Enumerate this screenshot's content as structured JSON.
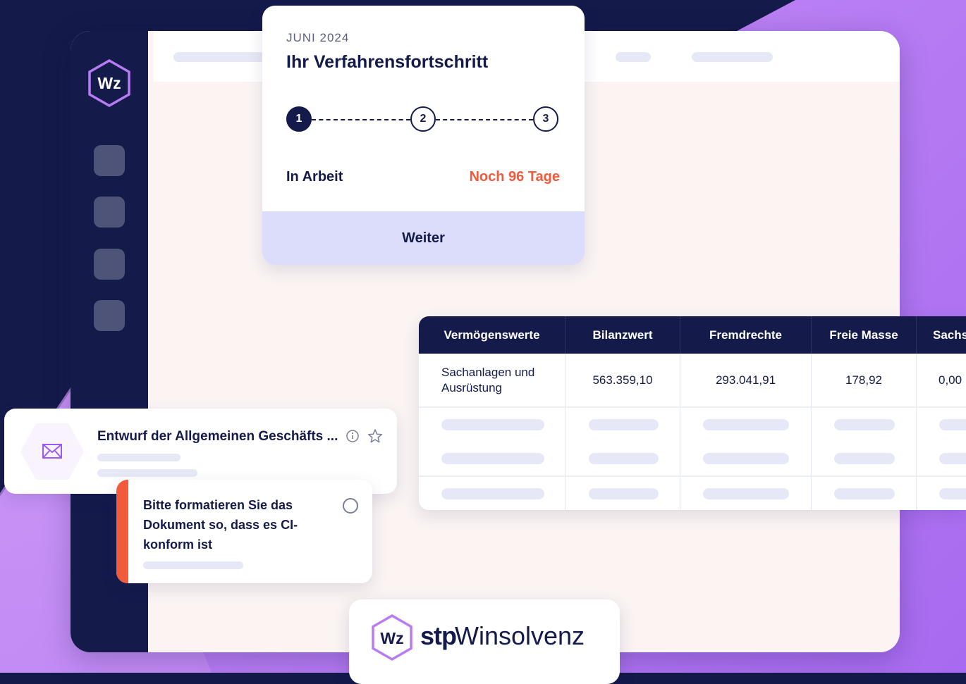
{
  "app": {
    "logo_text": "Wz"
  },
  "progress": {
    "month": "JUNI 2024",
    "title": "Ihr Verfahrensfortschritt",
    "steps": [
      "1",
      "2",
      "3"
    ],
    "active_step": 1,
    "status": "In Arbeit",
    "remaining": "Noch 96 Tage",
    "button": "Weiter"
  },
  "table": {
    "headers": [
      "Vermögenswerte",
      "Bilanzwert",
      "Fremdrechte",
      "Freie Masse",
      "Sachs"
    ],
    "row1": {
      "asset_line1": "Sachanlagen und",
      "asset_line2": "Ausrüstung",
      "bilanzwert": "563.359,10",
      "fremdrechte": "293.041,91",
      "freie_masse": "178,92",
      "sachs": "0,00"
    }
  },
  "mail": {
    "title": "Entwurf der Allgemeinen Geschäfts ...",
    "icon": "envelope-icon"
  },
  "task": {
    "text": "Bitte formatieren Sie das Dokument so, dass es CI-konform ist"
  },
  "brand": {
    "logo_text": "Wz",
    "prefix": "stp",
    "name": "Winsolvenz"
  },
  "colors": {
    "navy": "#141a4a",
    "accent_red": "#f25a3c",
    "purple": "#b77cf3",
    "button_bg": "#dcdcfb"
  }
}
